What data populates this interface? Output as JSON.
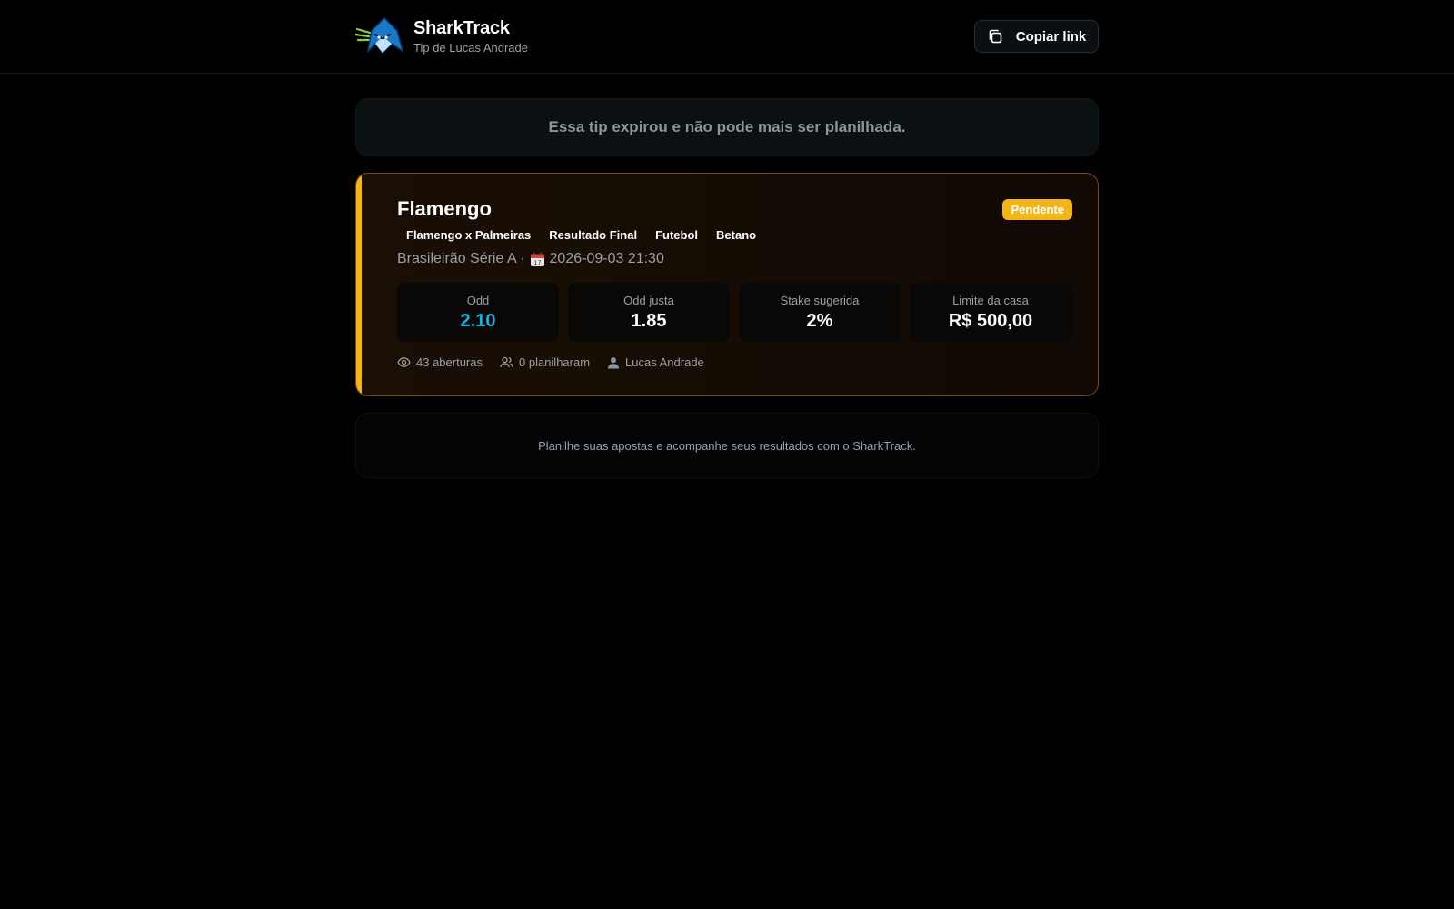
{
  "header": {
    "brand_name": "SharkTrack",
    "brand_subtitle": "Tip de Lucas Andrade",
    "logo_icon": "shark-logo-icon",
    "copy_button_label": "Copiar link",
    "copy_icon": "copy-icon"
  },
  "notice": {
    "text": "Essa tip expirou e não pode mais ser planilhada."
  },
  "tip": {
    "title": "Flamengo",
    "status_badge": "Pendente",
    "tags": [
      "Flamengo x Palmeiras",
      "Resultado Final",
      "Futebol",
      "Betano"
    ],
    "league": "Brasileirão Série A ·",
    "datetime": "2026-09-03 21:30",
    "stats": [
      {
        "label": "Odd",
        "value": "2.10"
      },
      {
        "label": "Odd justa",
        "value": "1.85"
      },
      {
        "label": "Stake sugerida",
        "value": "2%"
      },
      {
        "label": "Limite da casa",
        "value": "R$ 500,00"
      }
    ],
    "opens": "43 aberturas",
    "tracked": "0 planilharam",
    "author": "Lucas Andrade"
  },
  "promo": {
    "text": "Planilhe suas apostas e acompanhe seus resultados com o SharkTrack."
  },
  "colors": {
    "accent_bar": "#f5b314",
    "badge": "#f2b61a",
    "odd_value": "#1ab0e0",
    "card_border": "#7a4a17"
  }
}
